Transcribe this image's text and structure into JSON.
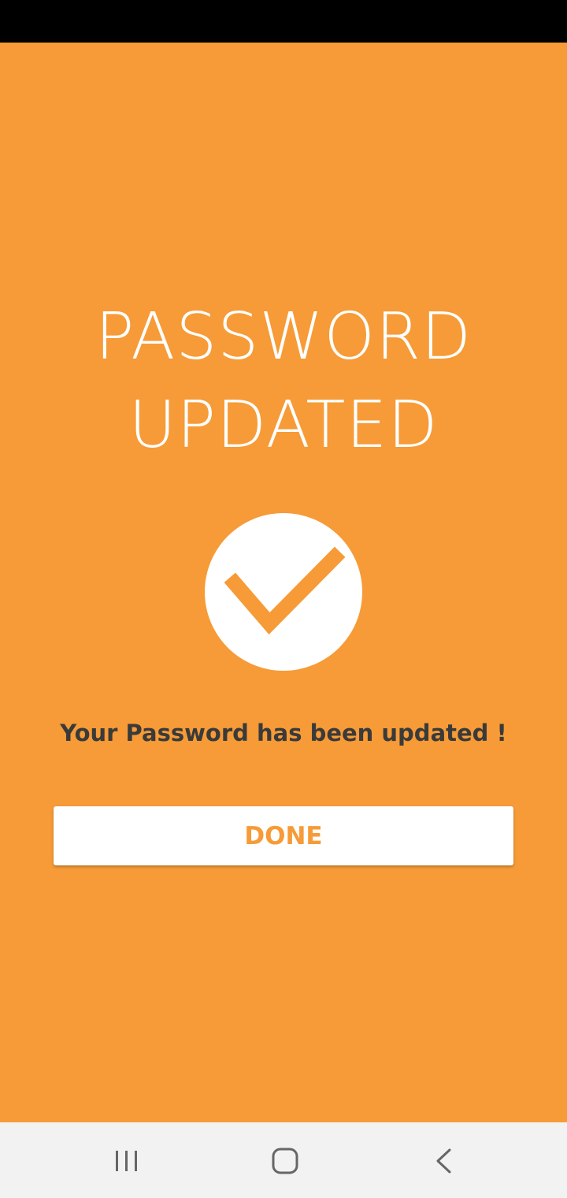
{
  "app": {
    "background_color": "#f69b37",
    "status_bar_color": "#000000",
    "nav_bar_color": "#f2f2f2"
  },
  "header": {
    "title_line1": "PASSWORD",
    "title_line2": "UPDATED"
  },
  "status": {
    "icon": "checkmark-circle-icon",
    "message": "Your Password has been updated !"
  },
  "actions": {
    "done_label": "DONE",
    "done_color": "#f69b37"
  },
  "navigation": {
    "recents_icon": "recent-apps-icon",
    "home_icon": "home-icon",
    "back_icon": "back-chevron-icon"
  }
}
